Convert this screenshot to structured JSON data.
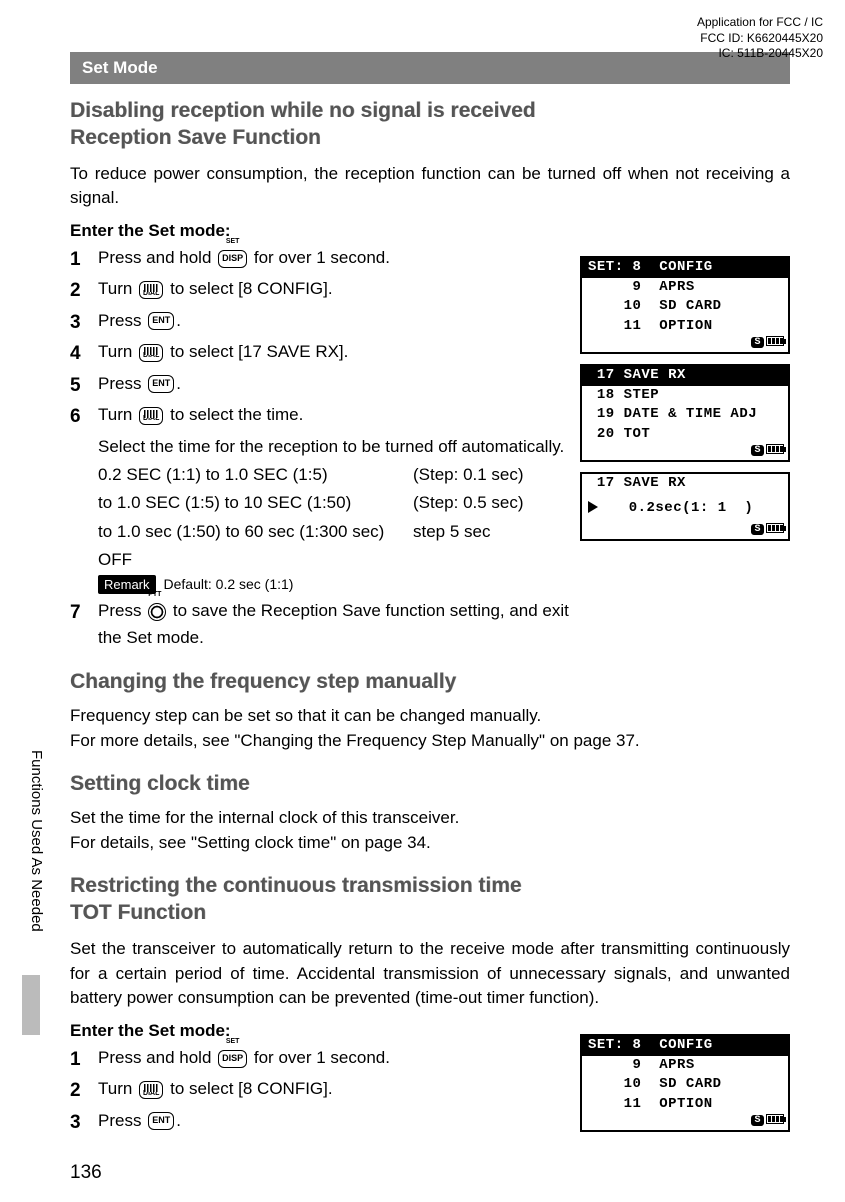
{
  "header": {
    "line1": "Application for FCC / IC",
    "line2": "FCC ID: K6620445X20",
    "line3": "IC: 511B-20445X20"
  },
  "set_mode_label": "Set Mode",
  "sec1": {
    "title_l1": "Disabling reception while no signal is received",
    "title_l2": "Reception Save Function",
    "intro": "To reduce power consumption, the reception function can be turned off when not receiving a signal.",
    "enter": "Enter the Set mode:",
    "steps": {
      "s1": "Press and hold ",
      "s1b": " for over 1 second.",
      "s2": "Turn ",
      "s2b": " to select [8 CONFIG].",
      "s3": "Press ",
      "s3b": ".",
      "s4": "Turn ",
      "s4b": " to select [17 SAVE RX].",
      "s5": "Press ",
      "s5b": ".",
      "s6": "Turn ",
      "s6b": " to select the time.",
      "s6_sub1": "Select the time for the reception to be turned off automatically.",
      "s6_r1a": "0.2 SEC (1:1) to 1.0 SEC (1:5)",
      "s6_r1b": "(Step: 0.1 sec)",
      "s6_r2a": "to 1.0 SEC (1:5) to 10 SEC (1:50)",
      "s6_r2b": "(Step: 0.5 sec)",
      "s6_r3a": "to 1.0 sec (1:50) to 60 sec (1:300 sec)",
      "s6_r3b": "step 5 sec",
      "s6_off": "OFF",
      "remark_label": "Remark",
      "remark_text": "Default: 0.2 sec (1:1)",
      "s7": "Press ",
      "s7b": " to save the Reception Save function setting, and exit the Set mode."
    }
  },
  "sec2": {
    "title": "Changing the frequency step manually",
    "p1": "Frequency step can be set so that it can be changed manually.",
    "p2": "For more details, see \"Changing the Frequency Step Manually\" on page 37."
  },
  "sec3": {
    "title": "Setting clock time",
    "p1": "Set the time for the internal clock of this transceiver.",
    "p2": "For details, see \"Setting clock time\" on page 34."
  },
  "sec4": {
    "title_l1": "Restricting the continuous transmission time",
    "title_l2": "TOT Function",
    "intro": "Set the transceiver to automatically return to the receive mode after transmitting continuously for a certain period of time. Accidental transmission of unnecessary signals, and unwanted battery power consumption can be prevented (time-out timer function).",
    "enter": "Enter the Set mode:",
    "steps": {
      "s1": "Press and hold ",
      "s1b": " for over 1 second.",
      "s2": "Turn ",
      "s2b": " to select [8 CONFIG].",
      "s3": "Press ",
      "s3b": "."
    }
  },
  "keys": {
    "disp": "DISP",
    "set": "SET",
    "dial": "DIAL",
    "ent": "ENT",
    "ptt": "PTT"
  },
  "lcds": {
    "config": {
      "r1": "SET: 8  CONFIG",
      "r2": "     9  APRS",
      "r3": "    10  SD CARD",
      "r4": "    11  OPTION"
    },
    "saverx_list": {
      "r1": " 17 SAVE RX",
      "r2": " 18 STEP",
      "r3": " 19 DATE & TIME ADJ",
      "r4": " 20 TOT"
    },
    "saverx_val": {
      "r1": " 17 SAVE RX",
      "r2": "   0.2sec(1: 1  )"
    }
  },
  "side_text": "Functions Used As Needed",
  "page_number": "136"
}
